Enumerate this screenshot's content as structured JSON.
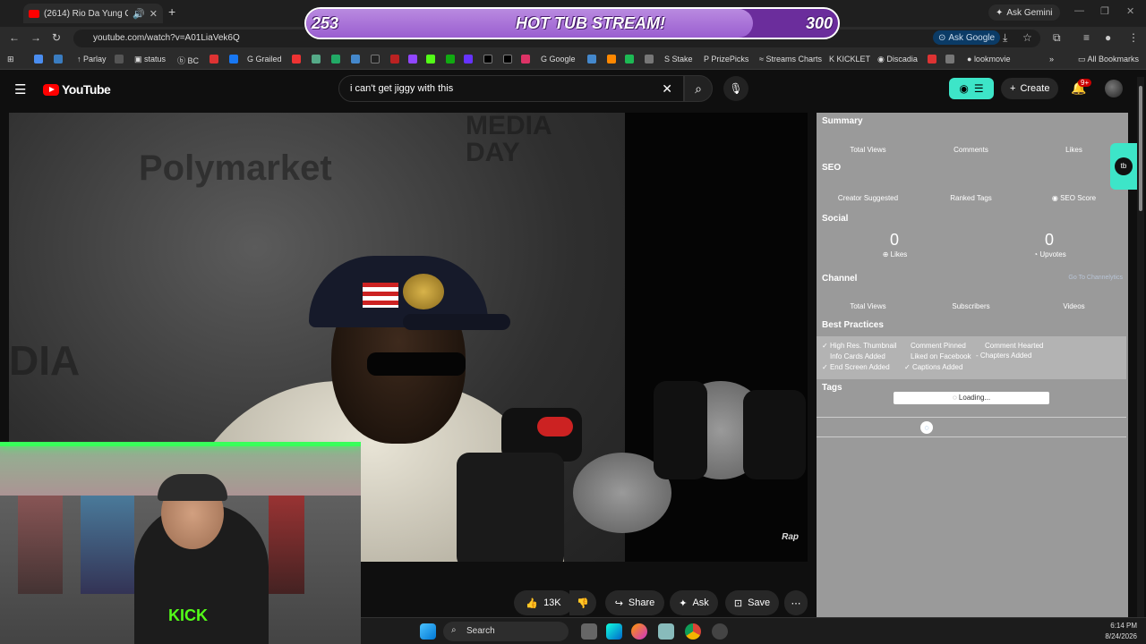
{
  "browser": {
    "tab_title": "(2614) Rio Da Yung Og - M",
    "ask_gemini": "Ask Gemini",
    "url": "youtube.com/watch?v=A01LiaVek6Q",
    "ask_google": "Ask Google"
  },
  "bookmarks": [
    "Parlay",
    "status",
    "BC",
    "Grailed",
    "Google",
    "Stake",
    "PrizePicks",
    "Streams Charts",
    "KICKLET",
    "Discadia",
    "lookmovie",
    "All Bookmarks"
  ],
  "overlay": {
    "left": "253",
    "title": "HOT TUB STREAM!",
    "right": "300",
    "progress": 0.84
  },
  "youtube": {
    "logo": "YouTube",
    "search_value": "i can't get jiggy with this",
    "create": "Create",
    "notif_count": "9+"
  },
  "video": {
    "wall_text1": "Polymarket",
    "wall_text2": "MEDIA DAY",
    "wall_text3": "DIA",
    "watermark": "Rap"
  },
  "actions": {
    "likes": "13K",
    "share": "Share",
    "ask": "Ask",
    "save": "Save"
  },
  "panel": {
    "summary": "Summary",
    "total_views": "Total Views",
    "comments": "Comments",
    "likes": "Likes",
    "seo": "SEO",
    "creator_suggested": "Creator Suggested",
    "ranked_tags": "Ranked Tags",
    "seo_score": "SEO Score",
    "social": "Social",
    "social_likes_val": "0",
    "social_likes": "Likes",
    "social_upvotes_val": "0",
    "social_upvotes": "Upvotes",
    "channel": "Channel",
    "go_to_channel": "Go To Channelytics",
    "ch_total_views": "Total Views",
    "ch_subscribers": "Subscribers",
    "ch_videos": "Videos",
    "best_practices": "Best Practices",
    "bp": [
      "High Res. Thumbnail",
      "Comment Pinned",
      "Comment Hearted",
      "Info Cards Added",
      "Liked on Facebook",
      "Chapters Added",
      "End Screen Added",
      "Captions Added"
    ],
    "tags": "Tags",
    "loading": "Loading..."
  },
  "webcam": {
    "shirt_text": "KICK"
  },
  "taskbar": {
    "search": "Search",
    "time": "6:14 PM",
    "date": "8/24/2026"
  }
}
